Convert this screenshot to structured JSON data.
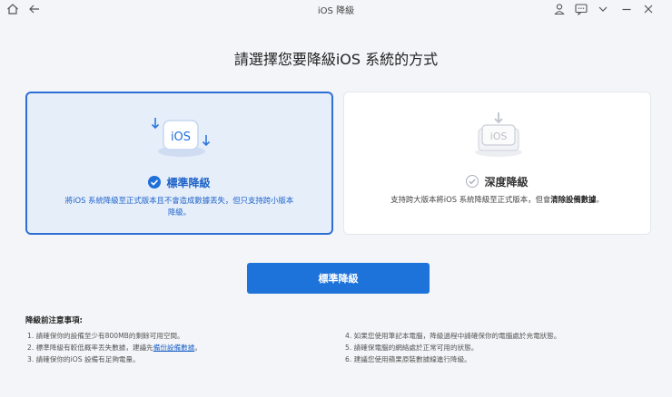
{
  "window": {
    "title": "iOS 降級"
  },
  "titlebar_icons": [
    "home-icon",
    "back-arrow-icon",
    "user-icon",
    "feedback-icon",
    "chevron-down-icon",
    "minimize-icon",
    "close-icon"
  ],
  "heading": "請選擇您要降級iOS 系統的方式",
  "options": [
    {
      "title": "標準降級",
      "description_line1": "將iOS 系統降級至正式版本且不會造成數據丟失，但只支持跨小版本",
      "description_line2": "降級。",
      "graphic_label": "iOS",
      "selected": true
    },
    {
      "title": "深度降級",
      "description_prefix": "支持跨大版本將iOS 系統降級至正式版本，但會",
      "description_emphasis": "清除設備數據",
      "description_suffix": "。",
      "graphic_label": "iOS",
      "selected": false
    }
  ],
  "primary_button": "標準降級",
  "notes": {
    "title": "降級前注意事項:",
    "left": [
      "1. 請確保你的設備至少有800MB的剩餘可用空間。",
      "2. 標準降級有較低概率丟失數據，建議先",
      "3. 請確保你的iOS 設備有足夠電量。"
    ],
    "backup_link": "備份設備數據",
    "backup_suffix": "。",
    "right": [
      "4. 如果您使用筆記本電腦，降級過程中請確保你的電腦處於充電狀態。",
      "5. 請確保電腦的網絡處於正常可用的狀態。",
      "6. 建議您使用蘋果原裝數據線進行降級。"
    ]
  },
  "colors": {
    "accent": "#1e73db",
    "selected_card_bg": "#e6eefa",
    "selected_border": "#2e6fd4",
    "page_bg": "#f3f5f8",
    "link": "#1e63c8"
  }
}
